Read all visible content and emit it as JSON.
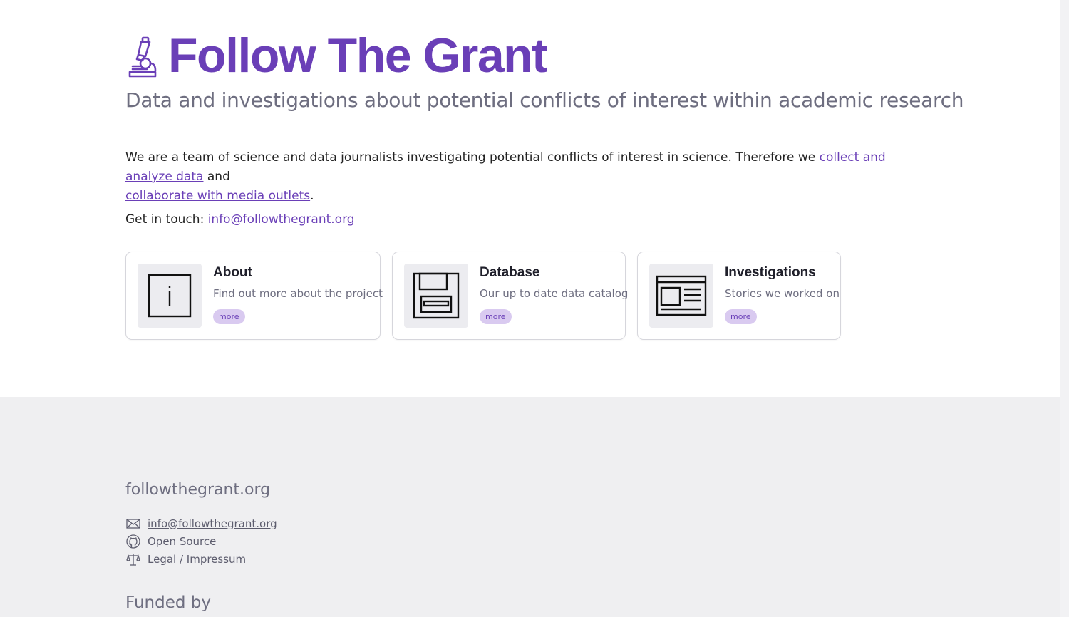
{
  "header": {
    "title": "Follow The Grant",
    "subtitle": "Data and investigations about potential conflicts of interest within academic research",
    "logo_icon": "microscope-icon"
  },
  "intro": {
    "text_before": "We are a team of science and data journalists investigating potential conflicts of interest in science. Therefore we ",
    "link1": "collect and analyze data",
    "text_middle": " and",
    "link2": "collaborate with media outlets",
    "text_after": "."
  },
  "contact": {
    "label": "Get in touch: ",
    "email": "info@followthegrant.org"
  },
  "cards": [
    {
      "title": "About",
      "description": "Find out more about the project",
      "button": "more",
      "icon": "info-icon"
    },
    {
      "title": "Database",
      "description": "Our up to date data catalog",
      "button": "more",
      "icon": "floppy-disk-icon"
    },
    {
      "title": "Investigations",
      "description": "Stories we worked on",
      "button": "more",
      "icon": "newspaper-icon"
    }
  ],
  "footer": {
    "site": "followthegrant.org",
    "links": [
      {
        "label": "info@followthegrant.org",
        "icon": "envelope-icon"
      },
      {
        "label": "Open Source",
        "icon": "github-icon"
      },
      {
        "label": "Legal / Impressum",
        "icon": "scales-icon"
      }
    ],
    "funded_by": "Funded by"
  },
  "colors": {
    "accent": "#6a3fb7",
    "button_bg": "#d9caf0",
    "footer_bg": "#efeff1",
    "muted_text": "#6e6e80"
  }
}
